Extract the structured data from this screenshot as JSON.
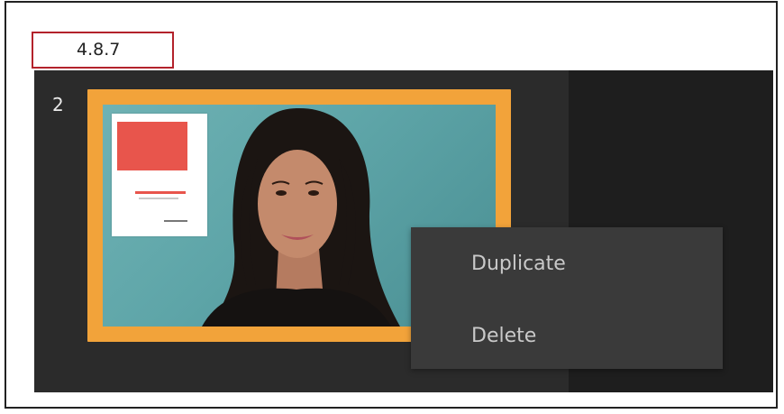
{
  "step_label": "4.8.7",
  "slide": {
    "number": "2"
  },
  "context_menu": {
    "items": [
      {
        "label": "Duplicate"
      },
      {
        "label": "Delete"
      }
    ]
  },
  "colors": {
    "selection_border": "#f2a33a",
    "panel_bg": "#2b2b2b",
    "menu_bg": "#3a3a3a",
    "label_border": "#b3222b"
  }
}
